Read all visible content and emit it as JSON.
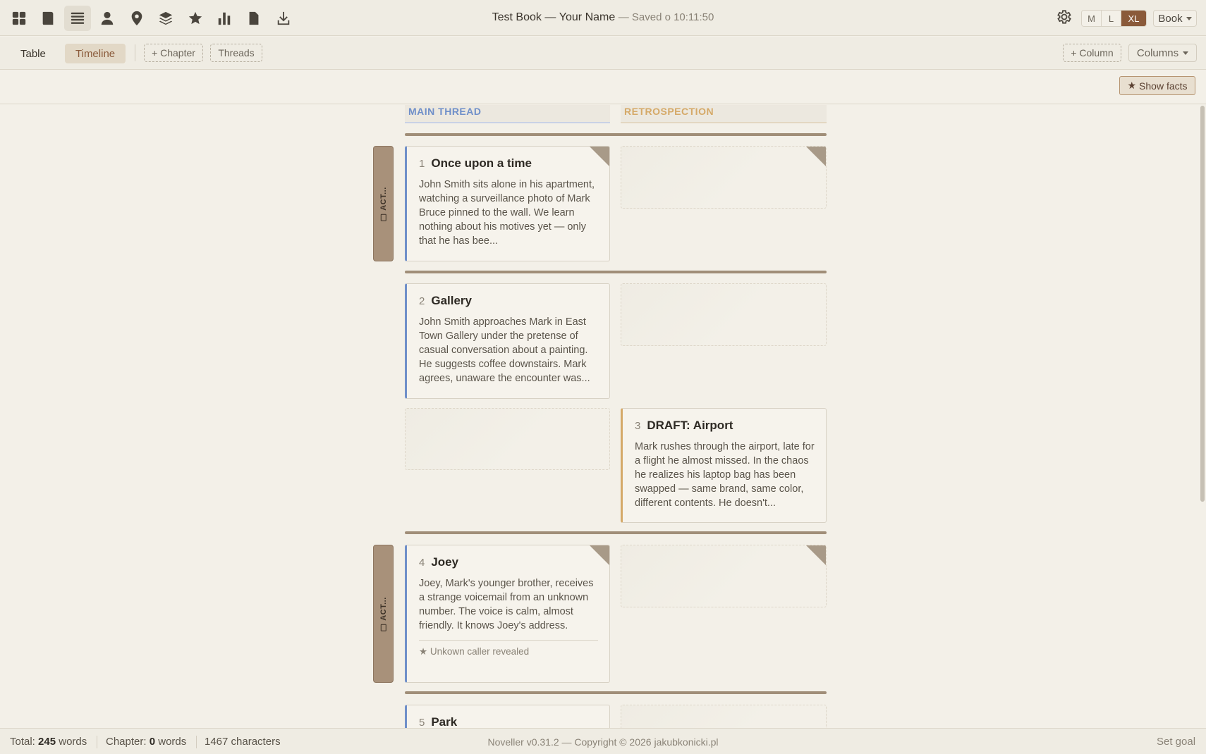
{
  "nav": {
    "icons": [
      "dashboard-icon",
      "book-icon",
      "list-icon",
      "person-icon",
      "location-pin-icon",
      "layers-icon",
      "star-icon",
      "bar-chart-icon",
      "document-icon",
      "download-icon"
    ],
    "active": "list-icon"
  },
  "header": {
    "book_title": "Test Book",
    "author": "Your Name",
    "saved_text": "Saved o 10:11:50",
    "sizes": [
      "M",
      "L",
      "XL"
    ],
    "selected_size": "XL",
    "view_mode": "Book"
  },
  "toolbar": {
    "tabs": [
      "Table",
      "Timeline"
    ],
    "active_tab": "Timeline",
    "add_chapter": "+ Chapter",
    "threads": "Threads",
    "add_column": "+ Column",
    "columns": "Columns",
    "show_facts": "Show facts"
  },
  "columns": [
    {
      "label": "MAIN THREAD",
      "color": "#6f8fc9"
    },
    {
      "label": "RETROSPECTION",
      "color": "#d5a968"
    }
  ],
  "acts": [
    {
      "label": "ACT..."
    },
    {
      "label": "ACT..."
    }
  ],
  "chapters": [
    {
      "num": "1",
      "title": "Once upon a time",
      "summary": "John Smith sits alone in his apartment, watching a surveillance photo of Mark Bruce pinned to the wall. We learn nothing about his motives yet — only that he has bee...",
      "thread": "MAIN THREAD"
    },
    {
      "num": "2",
      "title": "Gallery",
      "summary": "John Smith approaches Mark in East Town Gallery under the pretense of casual conversation about a painting. He suggests coffee downstairs. Mark agrees, unaware the encounter was...",
      "thread": "MAIN THREAD"
    },
    {
      "num": "3",
      "title": "DRAFT: Airport",
      "summary": "Mark rushes through the airport, late for a flight he almost missed. In the chaos he realizes his laptop bag has been swapped — same brand, same color, different contents. He doesn't...",
      "thread": "RETROSPECTION"
    },
    {
      "num": "4",
      "title": "Joey",
      "summary": "Joey, Mark's younger brother, receives a strange voicemail from an unknown number. The voice is calm, almost friendly. It knows Joey's address.",
      "fact": "★ Unkown caller revealed",
      "thread": "MAIN THREAD"
    },
    {
      "num": "5",
      "title": "Park",
      "thread": "MAIN THREAD"
    }
  ],
  "status": {
    "total_label": "Total:",
    "total_words": "245",
    "words_unit": "words",
    "chapter_label": "Chapter:",
    "chapter_words": "0",
    "characters": "1467 characters",
    "copyright": "Noveller v0.31.2 — Copyright © 2026 jakubkonicki.pl",
    "set_goal": "Set goal"
  },
  "colors": {
    "accent": "#8a5a3a",
    "main_thread": "#6f8fc9",
    "retrospection": "#d5a968",
    "act_marker": "#a8917a"
  }
}
